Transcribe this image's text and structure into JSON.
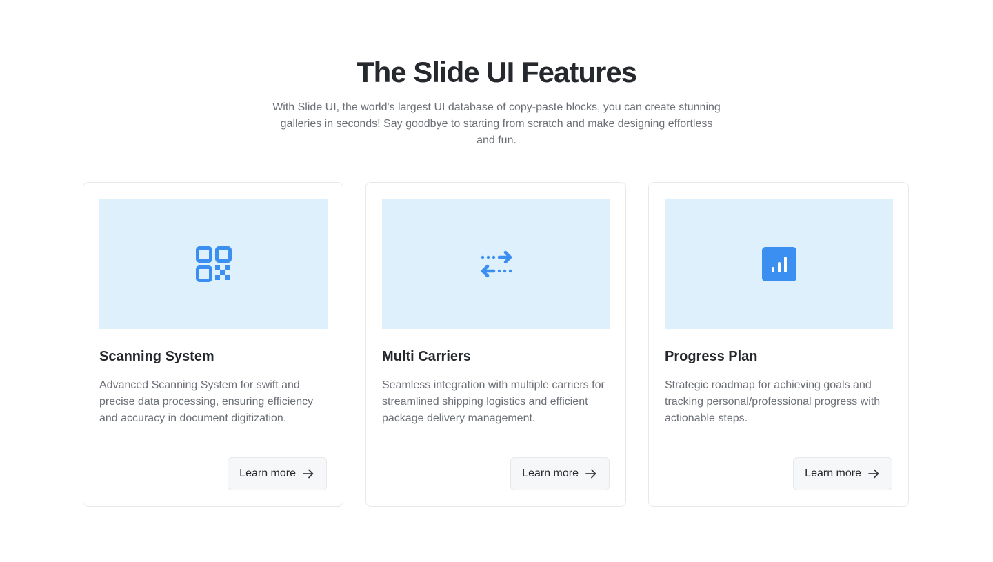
{
  "header": {
    "title": "The Slide UI Features",
    "subtitle": "With Slide UI, the world's largest UI database of copy-paste blocks, you can create stunning galleries in seconds! Say goodbye to starting from scratch and make designing effortless and fun."
  },
  "colors": {
    "accent": "#3b8ff0",
    "media_background": "#dff0fd",
    "title_text": "#25292e",
    "body_text": "#6b6f76",
    "button_background": "#f6f7f8"
  },
  "cards": [
    {
      "icon": "qr-code-icon",
      "title": "Scanning System",
      "description": "Advanced Scanning System for swift and precise data processing, ensuring efficiency and accuracy in document digitization.",
      "button_label": "Learn more"
    },
    {
      "icon": "transfer-arrows-icon",
      "title": "Multi Carriers",
      "description": "Seamless integration with multiple carriers for streamlined shipping logistics and efficient package delivery management.",
      "button_label": "Learn more"
    },
    {
      "icon": "bar-chart-icon",
      "title": "Progress Plan",
      "description": "Strategic roadmap for achieving goals and tracking personal/professional progress with actionable steps.",
      "button_label": "Learn more"
    }
  ]
}
